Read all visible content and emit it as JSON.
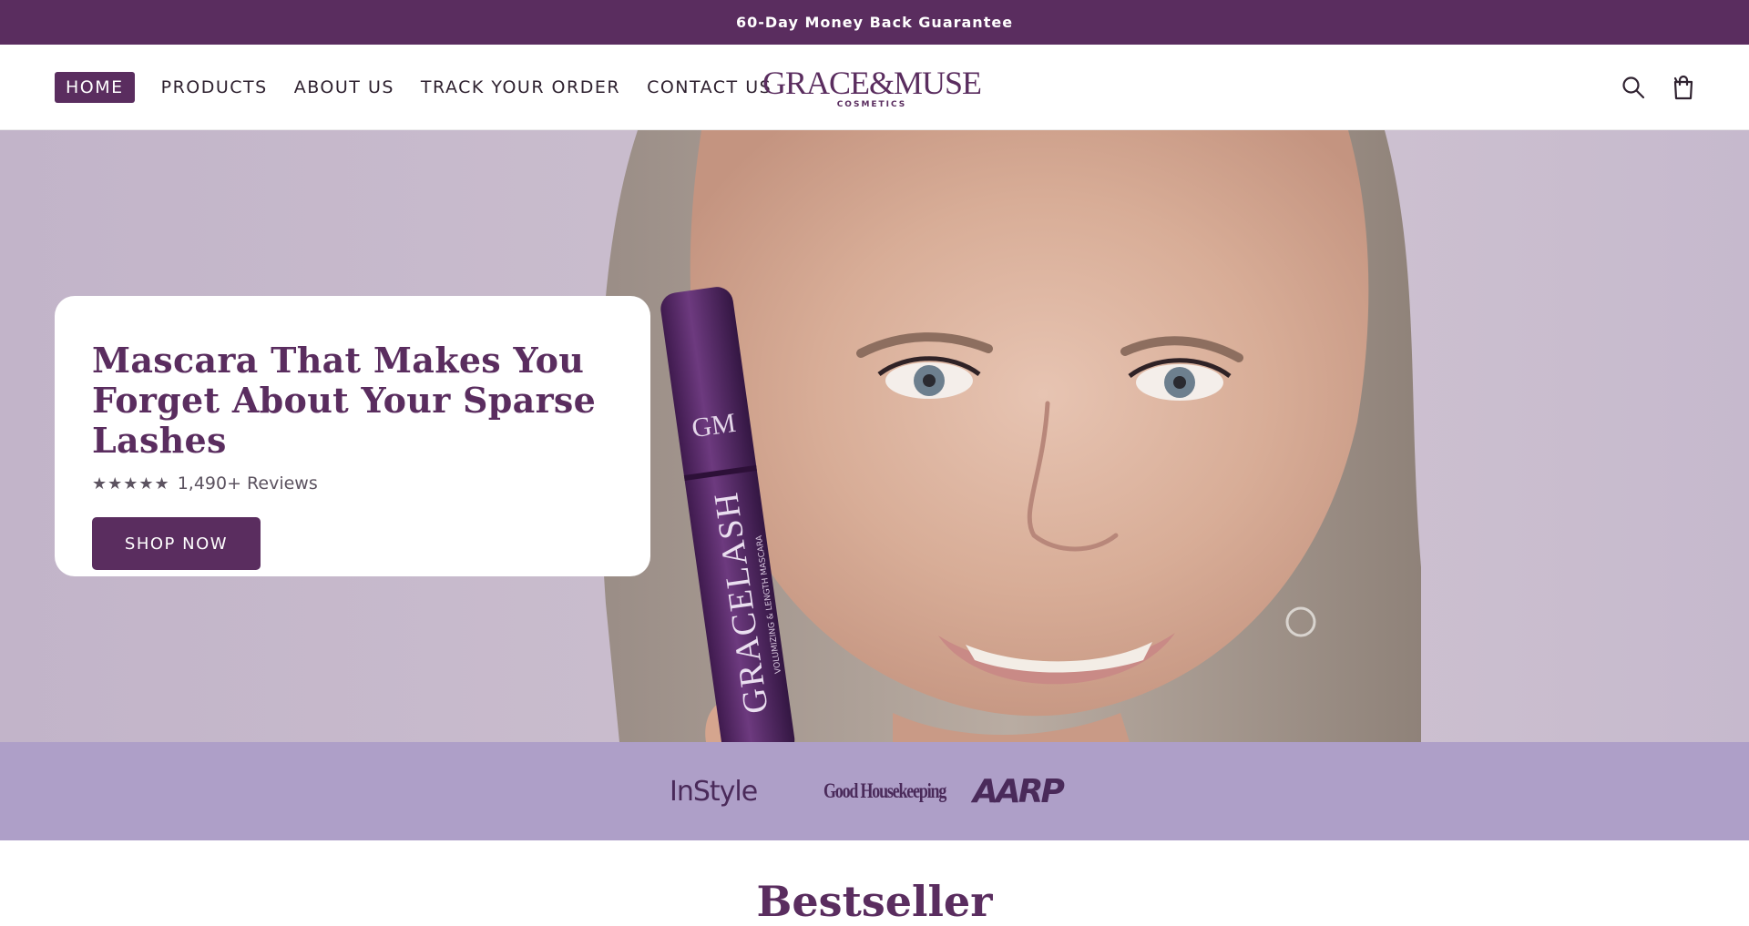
{
  "announcement": {
    "text": "60-Day Money Back Guarantee"
  },
  "nav": {
    "items": [
      {
        "label": "HOME",
        "active": true
      },
      {
        "label": "PRODUCTS"
      },
      {
        "label": "ABOUT US"
      },
      {
        "label": "TRACK YOUR ORDER"
      },
      {
        "label": "CONTACT US"
      }
    ]
  },
  "logo": {
    "main": "GRACE&MUSE",
    "sub": "COSMETICS"
  },
  "header_icons": {
    "search": "search-icon",
    "cart": "shopping-bag-icon"
  },
  "hero": {
    "title": "Mascara That Makes You Forget About Your Sparse Lashes",
    "stars": "★★★★★",
    "rating": 5,
    "reviews": "1,490+ Reviews",
    "cta": "SHOP NOW",
    "product_cap_text": "GM",
    "product_text": "GRACELASH",
    "product_subtext": "VOLUMIZING & LENGTH MASCARA"
  },
  "press": {
    "logos": [
      "InStyle",
      "Good Housekeeping",
      "AARP"
    ]
  },
  "section": {
    "title": "Bestseller"
  },
  "colors": {
    "brand": "#5a2d5f",
    "press_bar": "#ae9fc8",
    "hero_bg": "#c9bccd",
    "white": "#ffffff"
  }
}
